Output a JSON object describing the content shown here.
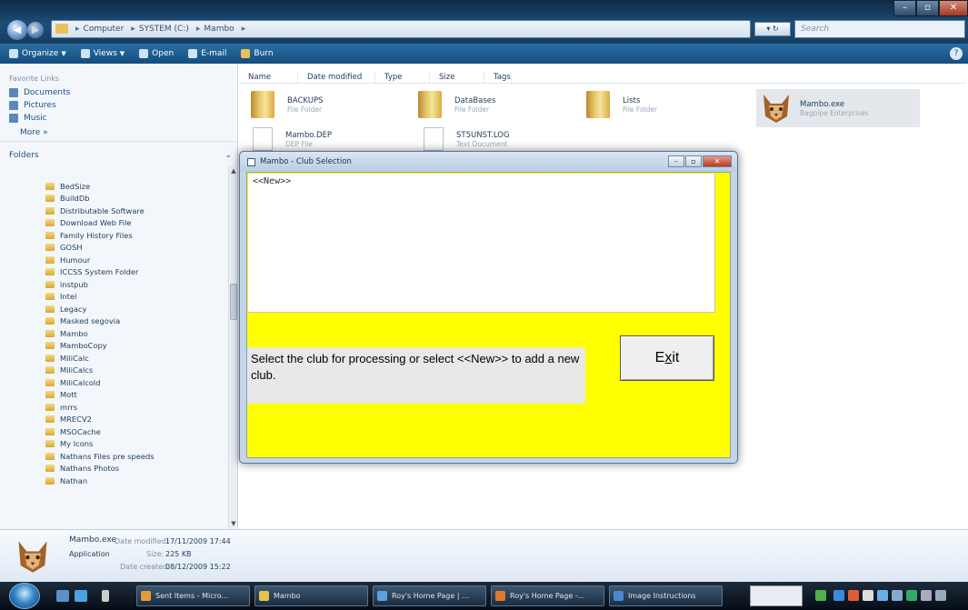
{
  "explorer": {
    "breadcrumbs": [
      "Computer",
      "SYSTEM (C:)",
      "Mambo"
    ],
    "search_placeholder": "Search",
    "toolbar": [
      "Organize",
      "Views",
      "Open",
      "E-mail",
      "Burn"
    ],
    "favorites_heading": "Favorite Links",
    "favorites": [
      "Documents",
      "Pictures",
      "Music"
    ],
    "more": "More »",
    "folders_label": "Folders",
    "folders": [
      "BedSize",
      "BuildDb",
      "Distributable Software",
      "Download Web File",
      "Family History Files",
      "GOSH",
      "Humour",
      "ICCSS System Folder",
      "instpub",
      "Intel",
      "Legacy",
      "Masked segovia",
      "Mambo",
      "MamboCopy",
      "MiliCalc",
      "MiliCalcs",
      "MiliCalcold",
      "Mott",
      "mrrs",
      "MRECV2",
      "MSOCache",
      "My Icons",
      "Nathans Files pre speeds",
      "Nathans Photos",
      "Nathan"
    ],
    "columns": [
      "Name",
      "Date modified",
      "Type",
      "Size",
      "Tags"
    ],
    "items": [
      {
        "name": "BACKUPS",
        "type": "File Folder"
      },
      {
        "name": "DataBases",
        "type": "File Folder"
      },
      {
        "name": "Lists",
        "type": "File Folder"
      },
      {
        "name": "Mambo.exe",
        "type": "Bagpipe Enterprises"
      },
      {
        "name": "Mambo.DEP",
        "type": "DEP File"
      },
      {
        "name": "ST5UNST.LOG",
        "type": "Text Document"
      }
    ],
    "details": {
      "filename": "Mambo.exe",
      "date_modified_label": "Date modified:",
      "date_modified": "17/11/2009 17:44",
      "kind": "Application",
      "size_label": "Size:",
      "size": "225 KB",
      "date_created_label": "Date created:",
      "date_created": "08/12/2009 15:22"
    }
  },
  "dialog": {
    "title": "Mambo - Club Selection",
    "list_items": [
      "<<New>>"
    ],
    "prompt": "Select the club for processing or select <<New>>  to add a new club.",
    "exit_label": "Exit",
    "bg_color": "#ffff00"
  },
  "taskbar": {
    "tasks": [
      "Sent Items - Micro...",
      "Mambo",
      "Roy's Home Page | ...",
      "Roy's Home Page -...",
      "Image Instructions"
    ]
  }
}
